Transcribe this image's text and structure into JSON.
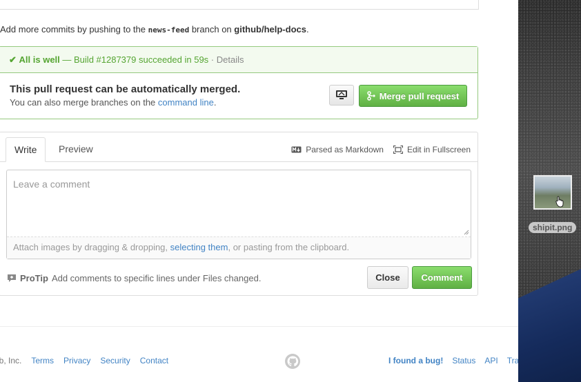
{
  "hint": {
    "prefix": "Add more commits by pushing to the ",
    "branch": "news-feed",
    "middle": " branch on ",
    "repo": "github/help-docs",
    "suffix": "."
  },
  "ci": {
    "check": "✔",
    "status": "All is well",
    "dash": " — ",
    "build": "Build #1287379 succeeded in 59s",
    "sep": " · ",
    "details": "Details"
  },
  "merge": {
    "title": "This pull request can be automatically merged.",
    "sub_prefix": "You can also merge branches on the ",
    "sub_link": "command line",
    "sub_suffix": ".",
    "button_label": "Merge pull request"
  },
  "comment": {
    "tab_write": "Write",
    "tab_preview": "Preview",
    "parsed_markdown": "Parsed as Markdown",
    "edit_fullscreen": "Edit in Fullscreen",
    "placeholder": "Leave a comment",
    "attach_prefix": "Attach images by dragging & dropping, ",
    "attach_link": "selecting them",
    "attach_suffix": ", or pasting from the clipboard.",
    "protip_label": "ProTip",
    "protip_text": "Add comments to specific lines under Files changed.",
    "close_label": "Close",
    "comment_label": "Comment"
  },
  "footer": {
    "copyright": "ub, Inc.",
    "left_links": [
      "Terms",
      "Privacy",
      "Security",
      "Contact"
    ],
    "bug": "I found a bug!",
    "right_links": [
      "Status",
      "API",
      "Trai"
    ]
  },
  "desktop": {
    "file_label": "shipit.png"
  },
  "colors": {
    "green": "#6cc644",
    "link": "#4183c4",
    "success_border": "#95c97e"
  }
}
